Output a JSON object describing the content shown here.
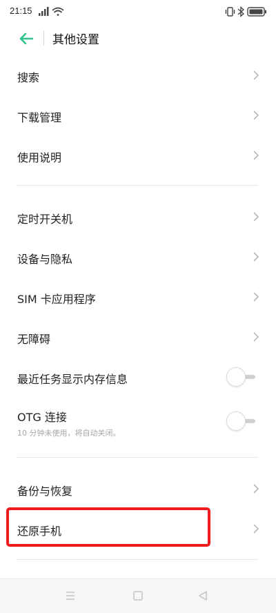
{
  "status_bar": {
    "time": "21:15",
    "icons": [
      "signal-icon",
      "wifi-icon",
      "vibrate-icon",
      "bluetooth-icon",
      "battery-icon"
    ]
  },
  "header": {
    "back_icon": "arrow-left-icon",
    "title": "其他设置"
  },
  "colors": {
    "accent": "#2fc38a",
    "highlight": "#ee1c1c"
  },
  "sections": [
    {
      "items": [
        {
          "label": "搜索"
        },
        {
          "label": "下载管理"
        },
        {
          "label": "使用说明"
        }
      ]
    },
    {
      "items": [
        {
          "label": "定时开关机"
        },
        {
          "label": "设备与隐私"
        },
        {
          "label": "SIM 卡应用程序"
        },
        {
          "label": "无障碍"
        },
        {
          "label": "最近任务显示内存信息",
          "toggle": false
        },
        {
          "label": "OTG 连接",
          "subtitle": "10 分钟未使用，将自动关闭。",
          "toggle": false
        }
      ]
    },
    {
      "items": [
        {
          "label": "备份与恢复"
        },
        {
          "label": "还原手机",
          "highlighted": true
        }
      ]
    }
  ],
  "nav_bar": {
    "icons": [
      "menu-icon",
      "home-icon",
      "back-triangle-icon"
    ]
  }
}
